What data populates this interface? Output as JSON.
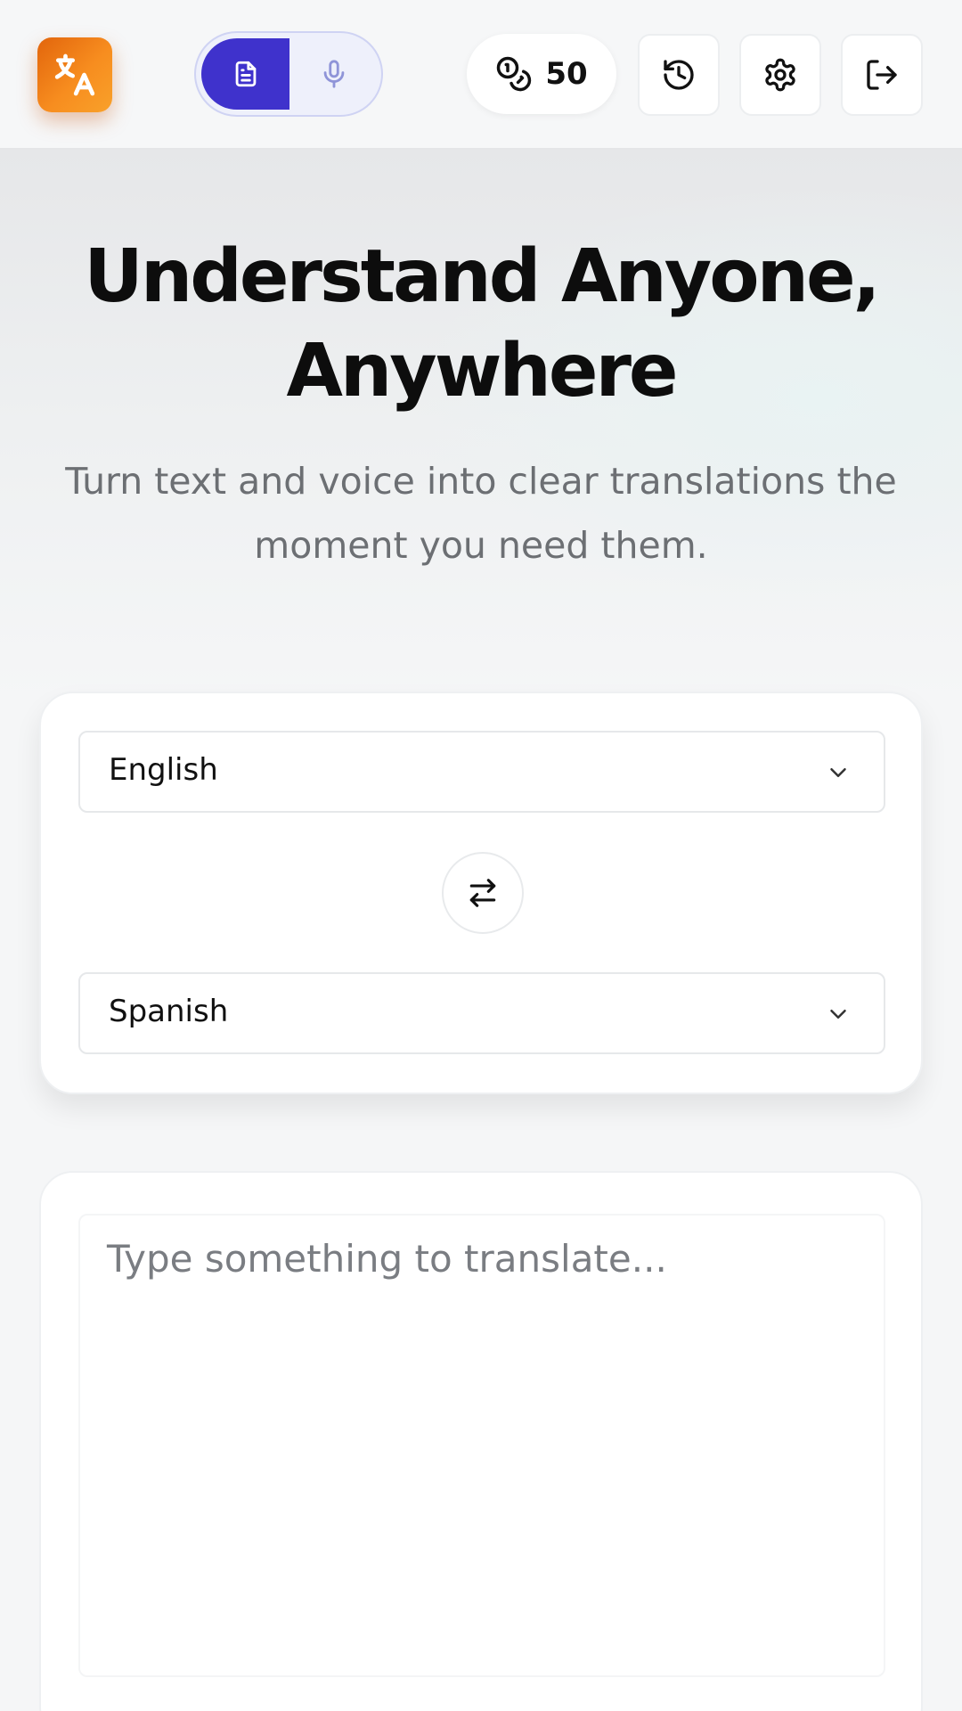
{
  "header": {
    "logo_icon": "translate-icon",
    "mode_toggle": {
      "text_mode_icon": "document-icon",
      "voice_mode_icon": "microphone-icon",
      "active": "text"
    },
    "credits": {
      "icon": "coins-icon",
      "count": "50"
    },
    "actions": [
      {
        "name": "history",
        "icon": "history-icon"
      },
      {
        "name": "settings",
        "icon": "gear-icon"
      },
      {
        "name": "logout",
        "icon": "logout-icon"
      }
    ]
  },
  "hero": {
    "title_line1": "Understand Anyone,",
    "title_line2": "Anywhere",
    "subtitle_line1": "Turn text and voice into clear translations the",
    "subtitle_line2": "moment you need them."
  },
  "languages": {
    "source": "English",
    "target": "Spanish",
    "swap_icon": "swap-icon"
  },
  "input": {
    "value": "",
    "placeholder": "Type something to translate..."
  },
  "colors": {
    "accent": "#3f32cc",
    "logo_gradient_start": "#e2650c",
    "logo_gradient_end": "#f9a12a"
  }
}
